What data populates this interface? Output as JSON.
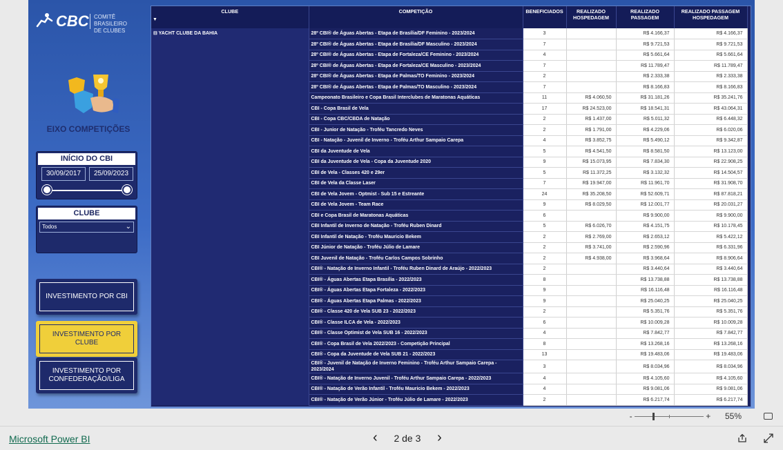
{
  "logo": {
    "brand": "CBC",
    "line1": "COMITÊ BRASILEIRO",
    "line2": "DE CLUBES"
  },
  "sidebar": {
    "eixo_title": "EIXO COMPETIÇÕES",
    "inicio_title": "INÍCIO DO CBI",
    "date_start": "30/09/2017",
    "date_end": "25/09/2023",
    "clube_title": "CLUBE",
    "clube_selected": "Todos",
    "buttons": [
      {
        "label": "INVESTIMENTO POR CBI",
        "active": false
      },
      {
        "label": "INVESTIMENTO POR CLUBE",
        "active": true
      },
      {
        "label": "INVESTIMENTO POR CONFEDERAÇÃO/LIGA",
        "active": false
      }
    ]
  },
  "table": {
    "headers": {
      "clube": "CLUBE",
      "competicao": "COMPETIÇÃO",
      "beneficiados": "BENEFICIADOS",
      "hospedagem": "REALIZADO HOSPEDAGEM",
      "passagem": "REALIZADO PASSAGEM",
      "passagem_hospedagem": "REALIZADO PASSAGEM HOSPEDAGEM"
    },
    "clube_group": "⊟  YACHT CLUBE DA BAHIA",
    "rows": [
      [
        "28º CBI® de Águas Abertas - Etapa de Brasília/DF Feminino - 2023/2024",
        "3",
        "",
        "R$ 4.166,37",
        "R$ 4.166,37"
      ],
      [
        "28º CBI® de Águas Abertas - Etapa de Brasília/DF Masculino - 2023/2024",
        "7",
        "",
        "R$ 9.721,53",
        "R$ 9.721,53"
      ],
      [
        "28º CBI® de Águas Abertas - Etapa de Fortaleza/CE Feminino - 2023/2024",
        "4",
        "",
        "R$ 5.661,64",
        "R$ 5.661,64"
      ],
      [
        "28º CBI® de Águas Abertas - Etapa de Fortaleza/CE Masculino - 2023/2024",
        "7",
        "",
        "R$ 11.789,47",
        "R$ 11.789,47"
      ],
      [
        "28º CBI® de Águas Abertas - Etapa de Palmas/TO Feminino - 2023/2024",
        "2",
        "",
        "R$ 2.333,38",
        "R$ 2.333,38"
      ],
      [
        "28º CBI® de Águas Abertas - Etapa de Palmas/TO Masculino - 2023/2024",
        "7",
        "",
        "R$ 8.166,83",
        "R$ 8.166,83"
      ],
      [
        "Campeonato Brasileiro e Copa Brasil Interclubes de Maratonas Aquáticas",
        "11",
        "R$ 4.060,50",
        "R$ 31.181,26",
        "R$ 35.241,76"
      ],
      [
        "CBI - Copa Brasil de Vela",
        "17",
        "R$ 24.523,00",
        "R$ 18.541,31",
        "R$ 43.064,31"
      ],
      [
        "CBI - Copa CBC/CBDA de Natação",
        "2",
        "R$ 1.437,00",
        "R$ 5.011,32",
        "R$ 6.448,32"
      ],
      [
        "CBI - Junior de Natação - Troféu Tancredo Neves",
        "2",
        "R$ 1.791,00",
        "R$ 4.229,06",
        "R$ 6.020,06"
      ],
      [
        "CBI - Natação - Juvenil de Inverno - Troféu Arthur Sampaio Carepa",
        "4",
        "R$ 3.852,75",
        "R$ 5.490,12",
        "R$ 9.342,87"
      ],
      [
        "CBI da Juventude de Vela",
        "5",
        "R$ 4.541,50",
        "R$ 8.581,50",
        "R$ 13.123,00"
      ],
      [
        "CBI da Juventude de Vela - Copa da Juventude 2020",
        "9",
        "R$ 15.073,95",
        "R$ 7.834,30",
        "R$ 22.908,25"
      ],
      [
        "CBI de Vela - Classes 420 e 29er",
        "5",
        "R$ 11.372,25",
        "R$ 3.132,32",
        "R$ 14.504,57"
      ],
      [
        "CBI de Vela da Classe Laser",
        "7",
        "R$ 19.947,00",
        "R$ 11.961,70",
        "R$ 31.908,70"
      ],
      [
        "CBI de Vela Jovem - Optmist - Sub 15 e Estreante",
        "24",
        "R$ 35.208,50",
        "R$ 52.609,71",
        "R$ 87.818,21"
      ],
      [
        "CBI de Vela Jovem - Team Race",
        "9",
        "R$ 8.029,50",
        "R$ 12.001,77",
        "R$ 20.031,27"
      ],
      [
        "CBI e Copa Brasil de Maratonas Aquáticas",
        "6",
        "",
        "R$ 9.900,00",
        "R$ 9.900,00"
      ],
      [
        "CBI Infantil de Inverno de Natação - Troféu Ruben Dinard",
        "5",
        "R$ 6.026,70",
        "R$ 4.151,75",
        "R$ 10.178,45"
      ],
      [
        "CBI Infantil de Natação - Troféu Mauricio Bekem",
        "2",
        "R$ 2.769,00",
        "R$ 2.653,12",
        "R$ 5.422,12"
      ],
      [
        "CBI Júnior de Natação - Troféu Júlio de Lamare",
        "2",
        "R$ 3.741,00",
        "R$ 2.590,96",
        "R$ 6.331,96"
      ],
      [
        "CBI Juvenil de Natação - Troféu Carlos Campos Sobrinho",
        "2",
        "R$ 4.938,00",
        "R$ 3.968,64",
        "R$ 8.906,64"
      ],
      [
        "CBI® - Natação de Inverno Infantil - Troféu Ruben Dinard de Araújo - 2022/2023",
        "2",
        "",
        "R$ 3.440,64",
        "R$ 3.440,64"
      ],
      [
        "CBI® - Águas Abertas Etapa Brasília - 2022/2023",
        "8",
        "",
        "R$ 13.738,88",
        "R$ 13.738,88"
      ],
      [
        "CBI® - Águas Abertas Etapa Fortaleza - 2022/2023",
        "9",
        "",
        "R$ 16.116,48",
        "R$ 16.116,48"
      ],
      [
        "CBI® - Águas Abertas Etapa Palmas - 2022/2023",
        "9",
        "",
        "R$ 25.040,25",
        "R$ 25.040,25"
      ],
      [
        "CBI® - Classe 420 de Vela SUB 23 - 2022/2023",
        "2",
        "",
        "R$ 5.351,76",
        "R$ 5.351,76"
      ],
      [
        "CBI® - Classe ILCA de Vela - 2022/2023",
        "6",
        "",
        "R$ 10.009,28",
        "R$ 10.009,28"
      ],
      [
        "CBI® - Classe Optimist de Vela SUB 16 - 2022/2023",
        "4",
        "",
        "R$ 7.842,77",
        "R$ 7.842,77"
      ],
      [
        "CBI® - Copa Brasil de Vela 2022/2023 - Competição Principal",
        "8",
        "",
        "R$ 13.268,16",
        "R$ 13.268,16"
      ],
      [
        "CBI® - Copa da Juventude de Vela SUB 21 - 2022/2023",
        "13",
        "",
        "R$ 19.483,06",
        "R$ 19.483,06"
      ],
      [
        "CBI® - Juvenil de Natação de Inverno Feminino - Troféu Arthur Sampaio Carepa - 2023/2024",
        "3",
        "",
        "R$ 8.034,96",
        "R$ 8.034,96"
      ],
      [
        "CBI® - Natação de Inverno Juvenil - Troféu Arthur Sampaio Carepa - 2022/2023",
        "4",
        "",
        "R$ 4.105,60",
        "R$ 4.105,60"
      ],
      [
        "CBI® - Natação de Verão Infantil - Troféu Mauricio Bekem - 2022/2023",
        "4",
        "",
        "R$ 9.081,06",
        "R$ 9.081,06"
      ],
      [
        "CBI® - Natação de Verão Júnior - Troféu Júlio de Lamare - 2022/2023",
        "2",
        "",
        "R$ 6.217,74",
        "R$ 6.217,74"
      ]
    ]
  },
  "zoom": {
    "minus": "-",
    "plus": "+",
    "level": "55%"
  },
  "footer": {
    "powerbi": "Microsoft Power BI",
    "page": "2 de 3",
    "prev": "‹",
    "next": "›"
  }
}
